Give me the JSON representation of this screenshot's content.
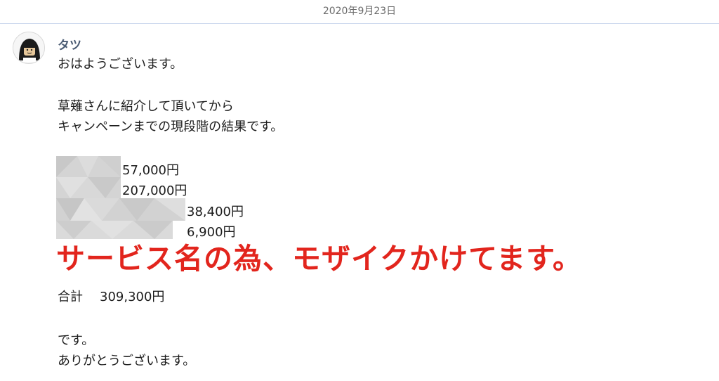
{
  "header": {
    "date": "2020年9月23日"
  },
  "message": {
    "sender": "タツ",
    "greeting": "おはようございます。",
    "intro_line1": "草薙さんに紹介して頂いてから",
    "intro_line2": "キャンペーンまでの現段階の結果です。",
    "results": [
      {
        "amount": "57,000円"
      },
      {
        "amount": "207,000円"
      },
      {
        "amount": "38,400円"
      },
      {
        "amount": "6,900円"
      }
    ],
    "total_label": "合計",
    "total_value": "309,300円",
    "closing1": "です。",
    "closing2": "ありがとうございます。"
  },
  "overlay": {
    "caption": "サービス名の為、モザイクかけてます。",
    "caption_color": "#e2251d"
  }
}
